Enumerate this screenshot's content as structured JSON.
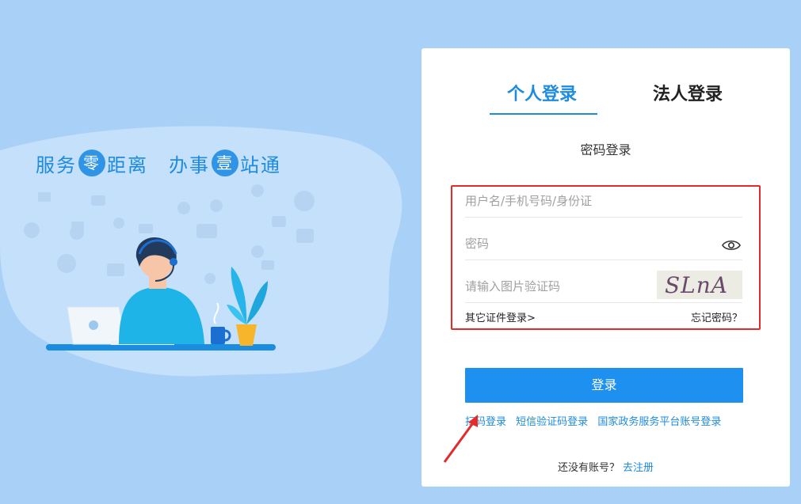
{
  "slogan": {
    "part1_a": "服务",
    "part1_circle": "零",
    "part1_b": "距离",
    "part2_a": "办事",
    "part2_circle": "壹",
    "part2_b": "站通"
  },
  "tabs": {
    "personal": "个人登录",
    "legal": "法人登录",
    "active": "personal"
  },
  "subtitle": "密码登录",
  "form": {
    "username_placeholder": "用户名/手机号码/身份证",
    "password_placeholder": "密码",
    "captcha_placeholder": "请输入图片验证码",
    "captcha_text": "SLnA",
    "other_cert": "其它证件登录>",
    "forgot": "忘记密码？"
  },
  "login_button": "登录",
  "alt_logins": {
    "qr": "扫码登录",
    "sms": "短信验证码登录",
    "national": "国家政务服务平台账号登录"
  },
  "register": {
    "prompt": "还没有账号？",
    "link": "去注册"
  },
  "colors": {
    "background": "#a9d0f6",
    "accent": "#1e8bde",
    "button": "#1e90f0",
    "highlight_box": "#e32b2b"
  }
}
